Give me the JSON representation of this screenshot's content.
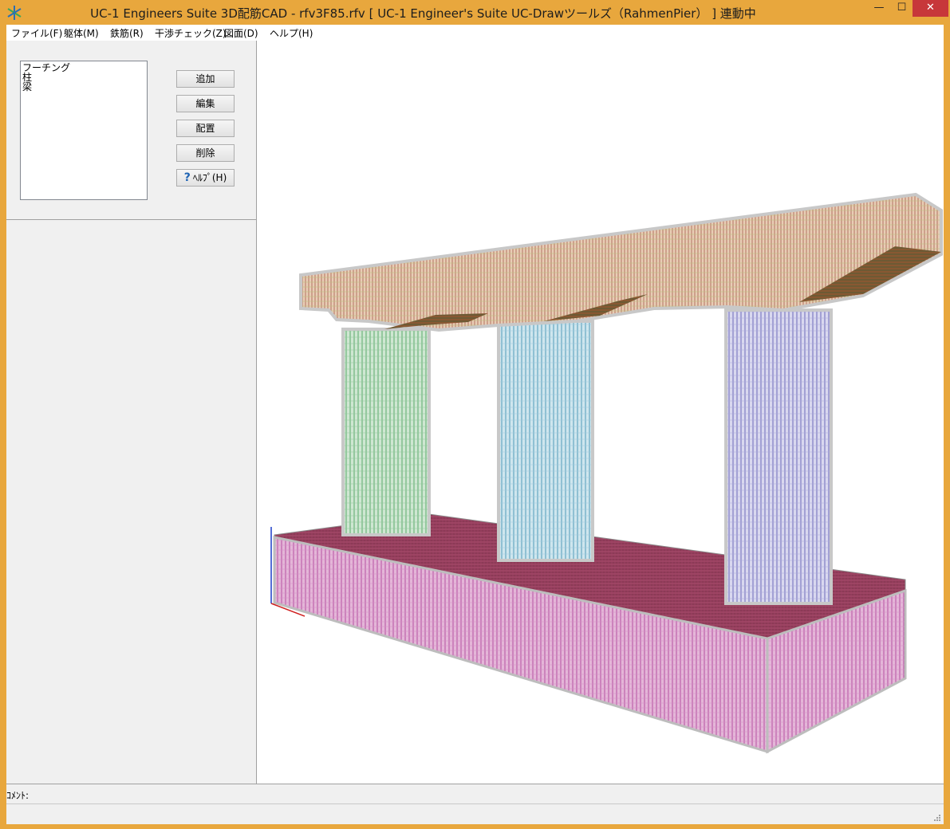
{
  "window": {
    "title": "UC-1 Engineers Suite 3D配筋CAD - rfv3F85.rfv [ UC-1 Engineer's Suite UC-Drawツールズ（RahmenPier） ] 連動中",
    "minimize_glyph": "—",
    "maximize_glyph": "☐",
    "close_glyph": "✕",
    "accent_color": "#e8a73d"
  },
  "menu": {
    "items": [
      {
        "label": "ファイル(F)"
      },
      {
        "label": "躯体(M)"
      },
      {
        "label": "鉄筋(R)"
      },
      {
        "label": "干渉チェック(Z)"
      },
      {
        "label": "図面(D)"
      },
      {
        "label": "ヘルプ(H)"
      }
    ]
  },
  "members": {
    "items": [
      "フーチング",
      "柱",
      "梁"
    ]
  },
  "buttons": {
    "add": "追加",
    "edit": "編集",
    "place": "配置",
    "delete": "削除",
    "help": "ﾍﾙﾌﾟ(H)",
    "help_icon": "question-icon"
  },
  "comment": {
    "label": "ｺﾒﾝﾄ:"
  },
  "viewport": {
    "model": "rahmen-pier-rebar-3d",
    "colors": {
      "footing": "#c96fb4",
      "footing_top": "#8c3a56",
      "beam": "#c89a7a",
      "column_left": "#7fc48a",
      "column_mid": "#79b9cf",
      "column_right": "#8a86cf"
    }
  }
}
